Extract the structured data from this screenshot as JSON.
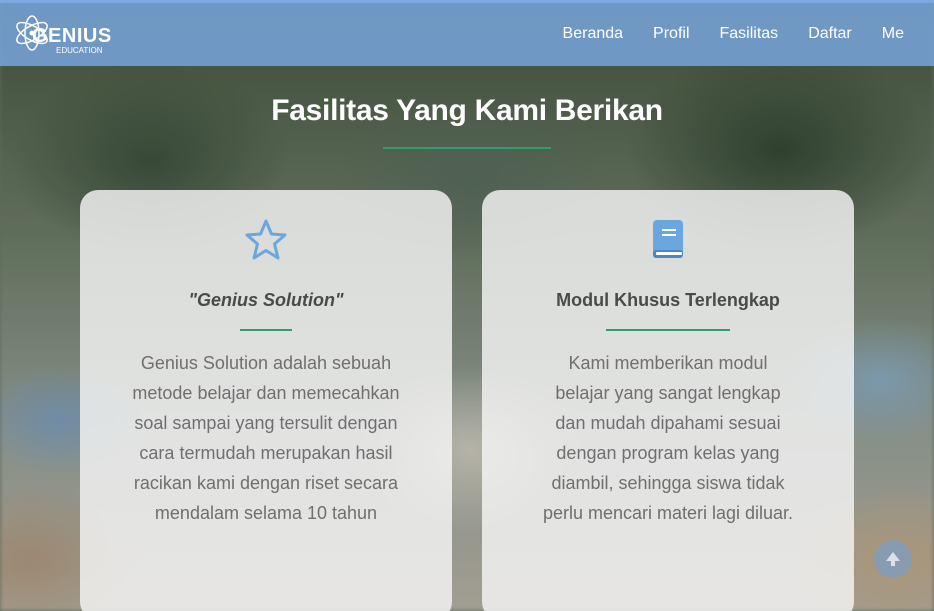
{
  "brand": {
    "name": "GENIUS",
    "sub": "EDUCATION"
  },
  "nav": {
    "items": [
      {
        "label": "Beranda"
      },
      {
        "label": "Profil"
      },
      {
        "label": "Fasilitas"
      },
      {
        "label": "Daftar"
      },
      {
        "label": "Me"
      }
    ]
  },
  "section": {
    "title": "Fasilitas Yang Kami Berikan"
  },
  "cards": [
    {
      "icon": "star-icon",
      "title": "\"Genius Solution\"",
      "text": "Genius Solution adalah sebuah metode belajar dan memecahkan soal sampai yang tersulit dengan cara termudah merupakan hasil racikan kami dengan riset secara mendalam selama 10 tahun"
    },
    {
      "icon": "book-icon",
      "title": "Modul Khusus Terlengkap",
      "text": "Kami memberikan modul belajar yang sangat lengkap dan mudah dipahami sesuai dengan program kelas yang diambil, sehingga siswa tidak perlu mencari materi lagi diluar."
    }
  ],
  "colors": {
    "navbar": "#78a5dc",
    "accent_line": "#2f9e6c",
    "icon": "#6aa6e0"
  }
}
